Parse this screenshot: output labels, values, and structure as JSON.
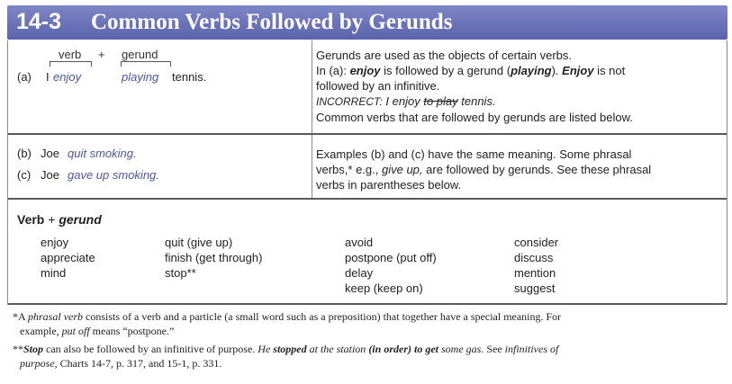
{
  "header": {
    "number": "14-3",
    "title": "Common Verbs Followed by Gerunds"
  },
  "example_a": {
    "label_verb": "verb",
    "label_plus": "+",
    "label_gerund": "gerund",
    "tag": "(a)",
    "subject": "I",
    "verb": "enjoy",
    "gerund": "playing",
    "rest": "tennis."
  },
  "explanation_a": {
    "line1": "Gerunds are used as the objects of certain verbs.",
    "line2_pre": "In (a): ",
    "line2_b1": "enjoy",
    "line2_mid": " is followed by a gerund (",
    "line2_b2": "playing",
    "line2_mid2": ").  ",
    "line2_b3": "Enjoy",
    "line2_post": " is not",
    "line3": "followed by an infinitive.",
    "incorrect_label": "INCORRECT:",
    "incorrect_pre": "I enjoy ",
    "incorrect_strike": "to play",
    "incorrect_post": " tennis.",
    "line5": "Common verbs that are followed by gerunds are listed below."
  },
  "example_b": {
    "tag": "(b)",
    "subject": "Joe",
    "verb": "quit smoking."
  },
  "example_c": {
    "tag": "(c)",
    "subject": "Joe",
    "verb": "gave up smoking."
  },
  "explanation_bc": {
    "line1": "Examples (b) and (c) have the same meaning.  Some phrasal",
    "line2_pre": "verbs,* e.g., ",
    "line2_i": "give up,",
    "line2_post": " are followed by gerunds.  See these phrasal",
    "line3": "verbs in parentheses below."
  },
  "verb_table": {
    "title_verb": "Verb",
    "title_plus": " + ",
    "title_gerund": "gerund",
    "columns": [
      [
        "enjoy",
        "appreciate",
        "mind"
      ],
      [
        "quit (give up)",
        "finish (get through)",
        "stop**"
      ],
      [
        "avoid",
        "postpone (put off)",
        "delay",
        "keep (keep on)"
      ],
      [
        "consider",
        "discuss",
        "mention",
        "suggest"
      ]
    ]
  },
  "footnotes": {
    "f1_pre": "*A ",
    "f1_i": "phrasal verb",
    "f1_post": " consists of a verb and a particle (a small word such as a preposition) that together have a special meaning.  For",
    "f1_line2_pre": "example, ",
    "f1_line2_i": "put off",
    "f1_line2_post": " means “postpone.”",
    "f2_pre": "**",
    "f2_b": "Stop",
    "f2_mid": " can also be followed by an infinitive of purpose.  ",
    "f2_i1": "He ",
    "f2_b2": "stopped",
    "f2_i2": " at the station ",
    "f2_b3": "(in order) to get",
    "f2_i3": " some gas.",
    "f2_mid2": "  See ",
    "f2_i4": "infinitives of",
    "f2_line2_i": "purpose,",
    "f2_line2_post": " Charts 14-7, p. 317, and 15-1, p. 331."
  },
  "colors": {
    "header": "#6169b2",
    "accent_text": "#4a56a8"
  }
}
